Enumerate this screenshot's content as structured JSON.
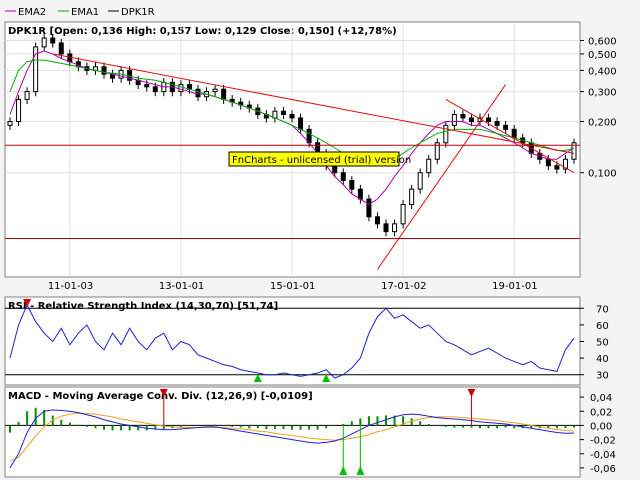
{
  "legend": [
    {
      "name": "EMA2",
      "color": "#b000b0"
    },
    {
      "name": "EMA1",
      "color": "#00b000"
    },
    {
      "name": "DPK1R",
      "color": "#000000"
    }
  ],
  "watermark": "FnCharts - unlicensed (trial) version",
  "chart_data": [
    {
      "type": "candlestick",
      "title": "DPK1R [Open: 0,136  High: 0,157  Low: 0,129  Close: 0,150] (+12,78%)",
      "y_scale": "log",
      "ylim": [
        0.025,
        0.75
      ],
      "y_ticks": [
        "0,600",
        "0,500",
        "0,400",
        "0,300",
        "0,200",
        "0,100"
      ],
      "x_ticks": [
        "11-01-03",
        "13-01-01",
        "15-01-01",
        "17-01-02",
        "19-01-01"
      ],
      "series": [
        {
          "name": "DPK1R",
          "values": [
            0.2,
            0.27,
            0.3,
            0.55,
            0.62,
            0.58,
            0.5,
            0.45,
            0.42,
            0.4,
            0.42,
            0.38,
            0.36,
            0.4,
            0.35,
            0.33,
            0.32,
            0.3,
            0.34,
            0.3,
            0.33,
            0.31,
            0.28,
            0.3,
            0.31,
            0.27,
            0.26,
            0.25,
            0.24,
            0.22,
            0.21,
            0.23,
            0.22,
            0.21,
            0.18,
            0.15,
            0.13,
            0.11,
            0.1,
            0.09,
            0.08,
            0.07,
            0.055,
            0.05,
            0.045,
            0.05,
            0.065,
            0.08,
            0.1,
            0.12,
            0.15,
            0.19,
            0.22,
            0.21,
            0.2,
            0.21,
            0.2,
            0.19,
            0.18,
            0.16,
            0.15,
            0.13,
            0.12,
            0.11,
            0.105,
            0.12,
            0.15
          ]
        },
        {
          "name": "EMA2",
          "values": [
            0.22,
            0.3,
            0.4,
            0.5,
            0.52,
            0.5,
            0.47,
            0.45,
            0.43,
            0.41,
            0.4,
            0.39,
            0.38,
            0.37,
            0.36,
            0.35,
            0.34,
            0.33,
            0.32,
            0.32,
            0.31,
            0.3,
            0.29,
            0.29,
            0.28,
            0.27,
            0.26,
            0.25,
            0.24,
            0.23,
            0.22,
            0.21,
            0.2,
            0.19,
            0.17,
            0.15,
            0.13,
            0.11,
            0.095,
            0.085,
            0.075,
            0.07,
            0.065,
            0.07,
            0.08,
            0.095,
            0.11,
            0.13,
            0.15,
            0.17,
            0.19,
            0.2,
            0.2,
            0.2,
            0.19,
            0.19,
            0.18,
            0.17,
            0.16,
            0.15,
            0.14,
            0.13,
            0.125,
            0.12,
            0.12,
            0.13,
            0.14
          ]
        },
        {
          "name": "EMA1",
          "values": [
            0.3,
            0.4,
            0.45,
            0.46,
            0.46,
            0.45,
            0.44,
            0.43,
            0.42,
            0.41,
            0.4,
            0.39,
            0.385,
            0.38,
            0.37,
            0.36,
            0.355,
            0.35,
            0.34,
            0.33,
            0.32,
            0.31,
            0.3,
            0.29,
            0.28,
            0.27,
            0.26,
            0.25,
            0.24,
            0.23,
            0.22,
            0.21,
            0.2,
            0.19,
            0.18,
            0.17,
            0.16,
            0.15,
            0.14,
            0.13,
            0.12,
            0.115,
            0.11,
            0.11,
            0.115,
            0.12,
            0.13,
            0.14,
            0.15,
            0.16,
            0.17,
            0.175,
            0.18,
            0.18,
            0.18,
            0.18,
            0.175,
            0.17,
            0.165,
            0.16,
            0.155,
            0.15,
            0.145,
            0.14,
            0.135,
            0.135,
            0.14
          ]
        }
      ]
    },
    {
      "type": "line",
      "title": "RSI - Relative Strength Index (14,30,70) [51,74]",
      "ylim": [
        25,
        75
      ],
      "y_ticks": [
        "70",
        "60",
        "50",
        "40",
        "30"
      ],
      "levels": [
        30,
        70
      ],
      "series": [
        {
          "name": "RSI",
          "values": [
            40,
            60,
            72,
            62,
            55,
            50,
            58,
            48,
            55,
            60,
            50,
            45,
            55,
            48,
            58,
            50,
            45,
            52,
            55,
            45,
            50,
            48,
            42,
            40,
            38,
            36,
            35,
            33,
            32,
            31,
            30,
            30,
            31,
            30,
            29,
            30,
            31,
            33,
            28,
            30,
            34,
            40,
            55,
            65,
            70,
            64,
            66,
            62,
            58,
            60,
            55,
            50,
            48,
            45,
            42,
            44,
            46,
            43,
            40,
            38,
            36,
            38,
            34,
            33,
            32,
            45,
            52
          ]
        }
      ],
      "markers": [
        {
          "kind": "buy",
          "index": 29
        },
        {
          "kind": "buy",
          "index": 37
        },
        {
          "kind": "sell",
          "index": 2
        }
      ]
    },
    {
      "type": "bar+line",
      "title": "MACD - Moving Average Conv. Div. (12,26,9) [-0,0109]",
      "ylim": [
        -0.07,
        0.05
      ],
      "y_ticks": [
        "0,04",
        "0,02",
        "0,00",
        "-0,02",
        "-0,04",
        "-0,06"
      ],
      "series": [
        {
          "name": "MACD",
          "values": [
            -0.06,
            -0.04,
            -0.01,
            0.01,
            0.02,
            0.022,
            0.021,
            0.02,
            0.018,
            0.015,
            0.012,
            0.008,
            0.005,
            0.002,
            0.0,
            -0.002,
            -0.004,
            -0.005,
            -0.006,
            -0.006,
            -0.005,
            -0.004,
            -0.003,
            -0.002,
            -0.002,
            -0.004,
            -0.006,
            -0.008,
            -0.01,
            -0.012,
            -0.014,
            -0.016,
            -0.018,
            -0.02,
            -0.022,
            -0.024,
            -0.025,
            -0.024,
            -0.022,
            -0.018,
            -0.012,
            -0.006,
            0.0,
            0.004,
            0.008,
            0.012,
            0.015,
            0.016,
            0.015,
            0.013,
            0.011,
            0.01,
            0.009,
            0.008,
            0.007,
            0.005,
            0.004,
            0.003,
            0.002,
            0.0,
            -0.002,
            -0.004,
            -0.006,
            -0.008,
            -0.01,
            -0.011,
            -0.0109
          ]
        },
        {
          "name": "Signal",
          "values": [
            -0.05,
            -0.045,
            -0.03,
            -0.015,
            -0.002,
            0.008,
            0.013,
            0.016,
            0.017,
            0.017,
            0.016,
            0.014,
            0.012,
            0.009,
            0.007,
            0.005,
            0.003,
            0.001,
            -0.001,
            -0.002,
            -0.003,
            -0.003,
            -0.003,
            -0.003,
            -0.003,
            -0.003,
            -0.004,
            -0.005,
            -0.006,
            -0.008,
            -0.009,
            -0.011,
            -0.013,
            -0.014,
            -0.016,
            -0.018,
            -0.019,
            -0.02,
            -0.021,
            -0.02,
            -0.018,
            -0.016,
            -0.013,
            -0.009,
            -0.006,
            -0.002,
            0.002,
            0.006,
            0.009,
            0.011,
            0.012,
            0.012,
            0.012,
            0.011,
            0.01,
            0.009,
            0.008,
            0.007,
            0.005,
            0.004,
            0.002,
            0.0,
            -0.002,
            -0.004,
            -0.006,
            -0.007,
            -0.008
          ]
        }
      ],
      "markers": [
        {
          "kind": "sell",
          "index": 18
        },
        {
          "kind": "buy",
          "index": 39
        },
        {
          "kind": "sell",
          "index": 54
        },
        {
          "kind": "buy",
          "index": 41
        }
      ]
    }
  ],
  "trendlines": [
    {
      "name": "upper-resistance",
      "color": "#e01010"
    },
    {
      "name": "support-up",
      "color": "#e01010"
    },
    {
      "name": "short-resistance",
      "color": "#e01010"
    },
    {
      "name": "horizontal-1",
      "color": "#c00000"
    },
    {
      "name": "horizontal-2",
      "color": "#c00000"
    }
  ]
}
